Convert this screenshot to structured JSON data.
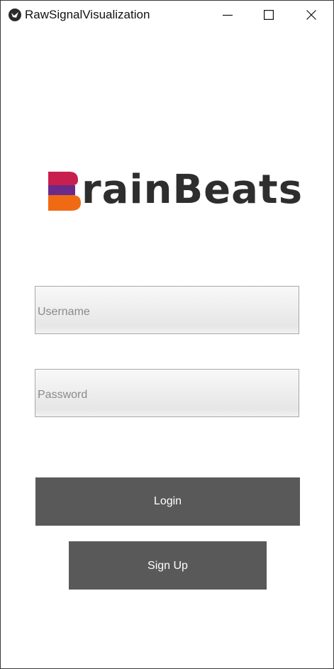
{
  "window": {
    "title": "RawSignalVisualization",
    "icon": "kivy-app-icon",
    "controls": [
      "minimize-icon",
      "maximize-icon",
      "close-icon"
    ]
  },
  "logo": {
    "text": "rainBeats",
    "brand_full": "BrainBeats",
    "colors": {
      "mark_top": "#c8204e",
      "mark_middle": "#6b2a8a",
      "mark_bottom": "#ef6a12",
      "text": "#2e2e2e"
    }
  },
  "form": {
    "username": {
      "value": "",
      "placeholder": "Username"
    },
    "password": {
      "value": "",
      "placeholder": "Password"
    }
  },
  "buttons": {
    "login_label": "Login",
    "signup_label": "Sign Up",
    "color": "#595959"
  }
}
